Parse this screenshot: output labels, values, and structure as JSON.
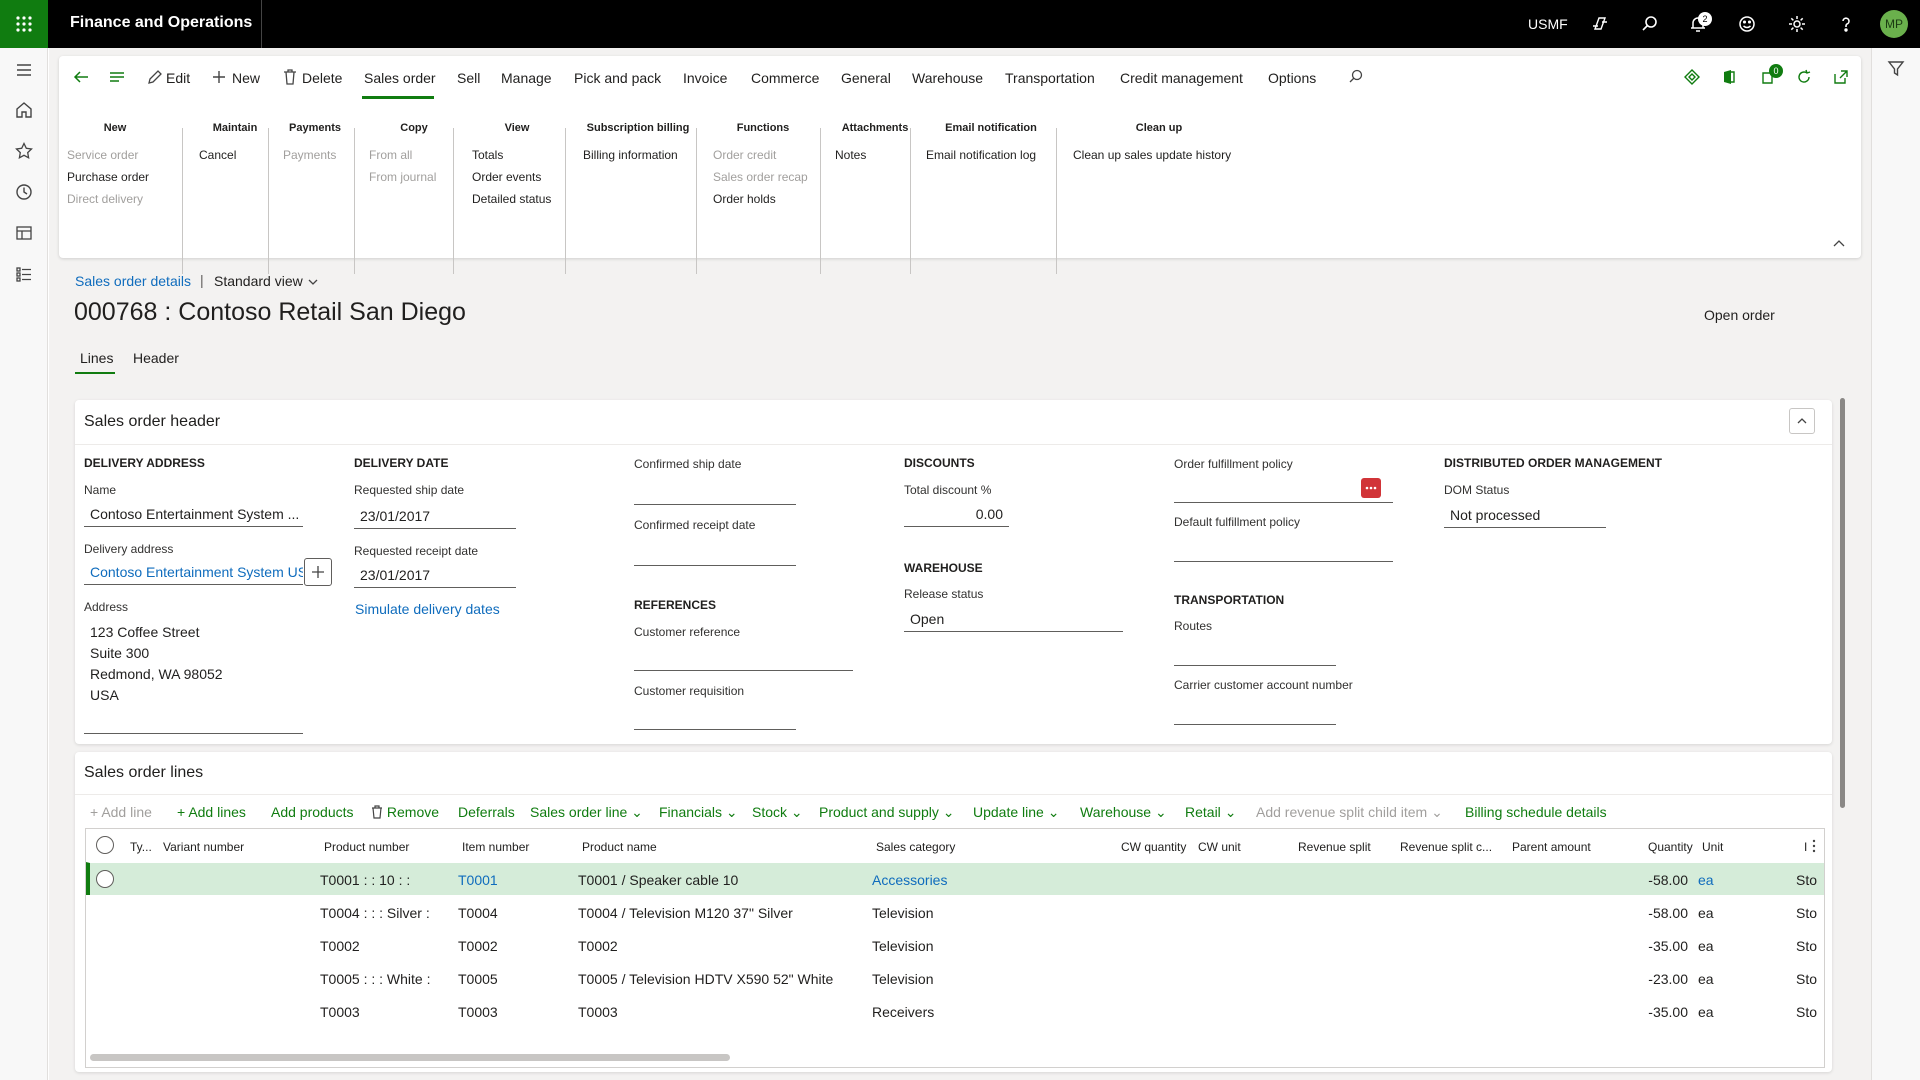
{
  "topbar": {
    "app_title": "Finance and Operations",
    "company": "USMF",
    "notifications": "2",
    "avatar": "MP"
  },
  "actionpane": {
    "buttons": {
      "edit": "Edit",
      "new": "New",
      "delete": "Delete"
    },
    "tabs": [
      "Sales order",
      "Sell",
      "Manage",
      "Pick and pack",
      "Invoice",
      "Commerce",
      "General",
      "Warehouse",
      "Transportation",
      "Credit management",
      "Options"
    ],
    "badge": "0",
    "groups": [
      {
        "title": "New",
        "items": [
          {
            "label": "Service order",
            "disabled": true
          },
          {
            "label": "Purchase order",
            "disabled": false
          },
          {
            "label": "Direct delivery",
            "disabled": true
          }
        ]
      },
      {
        "title": "Maintain",
        "items": [
          {
            "label": "Cancel",
            "disabled": false
          }
        ]
      },
      {
        "title": "Payments",
        "items": [
          {
            "label": "Payments",
            "disabled": true
          }
        ]
      },
      {
        "title": "Copy",
        "items": [
          {
            "label": "From all",
            "disabled": true
          },
          {
            "label": "From journal",
            "disabled": true
          }
        ]
      },
      {
        "title": "View",
        "items": [
          {
            "label": "Totals",
            "disabled": false
          },
          {
            "label": "Order events",
            "disabled": false
          },
          {
            "label": "Detailed status",
            "disabled": false
          }
        ]
      },
      {
        "title": "Subscription billing",
        "items": [
          {
            "label": "Billing information",
            "disabled": false
          }
        ]
      },
      {
        "title": "Functions",
        "items": [
          {
            "label": "Order credit",
            "disabled": true
          },
          {
            "label": "Sales order recap",
            "disabled": true
          },
          {
            "label": "Order holds",
            "disabled": false
          }
        ]
      },
      {
        "title": "Attachments",
        "items": [
          {
            "label": "Notes",
            "disabled": false
          }
        ]
      },
      {
        "title": "Email notification",
        "items": [
          {
            "label": "Email notification log",
            "disabled": false
          }
        ]
      },
      {
        "title": "Clean up",
        "items": [
          {
            "label": "Clean up sales update history",
            "disabled": false
          }
        ]
      }
    ]
  },
  "page": {
    "breadcrumb": "Sales order details",
    "crumb_sep": "|",
    "view": "Standard view",
    "title": "000768 : Contoso Retail San Diego",
    "status": "Open order",
    "tabs": [
      "Lines",
      "Header"
    ]
  },
  "header": {
    "title": "Sales order header",
    "delivery_address": {
      "section": "DELIVERY ADDRESS",
      "name_label": "Name",
      "name_value": "Contoso Entertainment System ...",
      "address_label": "Delivery address",
      "address_value": "Contoso Entertainment System USA",
      "addr_label": "Address",
      "address_lines": [
        "123 Coffee Street",
        "Suite 300",
        "Redmond, WA 98052",
        "USA"
      ]
    },
    "delivery_date": {
      "section": "DELIVERY DATE",
      "ship_label": "Requested ship date",
      "ship_value": "23/01/2017",
      "receipt_label": "Requested receipt date",
      "receipt_value": "23/01/2017",
      "simulate": "Simulate delivery dates"
    },
    "confirmed": {
      "ship_label": "Confirmed ship date",
      "receipt_label": "Confirmed receipt date"
    },
    "references": {
      "section": "REFERENCES",
      "customer_ref_label": "Customer reference",
      "customer_req_label": "Customer requisition"
    },
    "discounts": {
      "section": "DISCOUNTS",
      "total_label": "Total discount %",
      "total_value": "0.00"
    },
    "warehouse": {
      "section": "WAREHOUSE",
      "release_label": "Release status",
      "release_value": "Open"
    },
    "fulfillment": {
      "order_label": "Order fulfillment policy",
      "default_label": "Default fulfillment policy"
    },
    "transportation": {
      "section": "TRANSPORTATION",
      "routes_label": "Routes",
      "carrier_label": "Carrier customer account number"
    },
    "dom": {
      "section": "DISTRIBUTED ORDER MANAGEMENT",
      "status_label": "DOM Status",
      "status_value": "Not processed"
    }
  },
  "lines": {
    "title": "Sales order lines",
    "toolbar": {
      "add_line": "Add line",
      "add_lines": "Add lines",
      "add_products": "Add products",
      "remove": "Remove",
      "deferrals": "Deferrals",
      "sales_order_line": "Sales order line",
      "financials": "Financials",
      "stock": "Stock",
      "product_supply": "Product and supply",
      "update_line": "Update line",
      "warehouse": "Warehouse",
      "retail": "Retail",
      "revenue_split": "Add revenue split child item",
      "billing": "Billing schedule details"
    },
    "columns": [
      "Ty...",
      "Variant number",
      "Product number",
      "Item number",
      "Product name",
      "Sales category",
      "CW quantity",
      "CW unit",
      "Revenue split",
      "Revenue split c...",
      "Parent amount",
      "Quantity",
      "Unit",
      "I"
    ],
    "rows": [
      {
        "product_number": "T0001 : : 10 : :",
        "item_number": "T0001",
        "product_name": "T0001 / Speaker cable 10",
        "category": "Accessories",
        "quantity": "-58.00",
        "unit": "ea",
        "extra": "Sto"
      },
      {
        "product_number": "T0004 : : : Silver :",
        "item_number": "T0004",
        "product_name": "T0004 / Television M120 37\" Silver",
        "category": "Television",
        "quantity": "-58.00",
        "unit": "ea",
        "extra": "Sto"
      },
      {
        "product_number": "T0002",
        "item_number": "T0002",
        "product_name": "T0002",
        "category": "Television",
        "quantity": "-35.00",
        "unit": "ea",
        "extra": "Sto"
      },
      {
        "product_number": "T0005 : : : White :",
        "item_number": "T0005",
        "product_name": "T0005 / Television HDTV X590 52\" White",
        "category": "Television",
        "quantity": "-23.00",
        "unit": "ea",
        "extra": "Sto"
      },
      {
        "product_number": "T0003",
        "item_number": "T0003",
        "product_name": "T0003",
        "category": "Receivers",
        "quantity": "-35.00",
        "unit": "ea",
        "extra": "Sto"
      }
    ]
  },
  "colors": {
    "accent": "#107c10",
    "link": "#0f6cbd",
    "selected_row": "#d5ecd9",
    "dots_button": "#d13438"
  }
}
